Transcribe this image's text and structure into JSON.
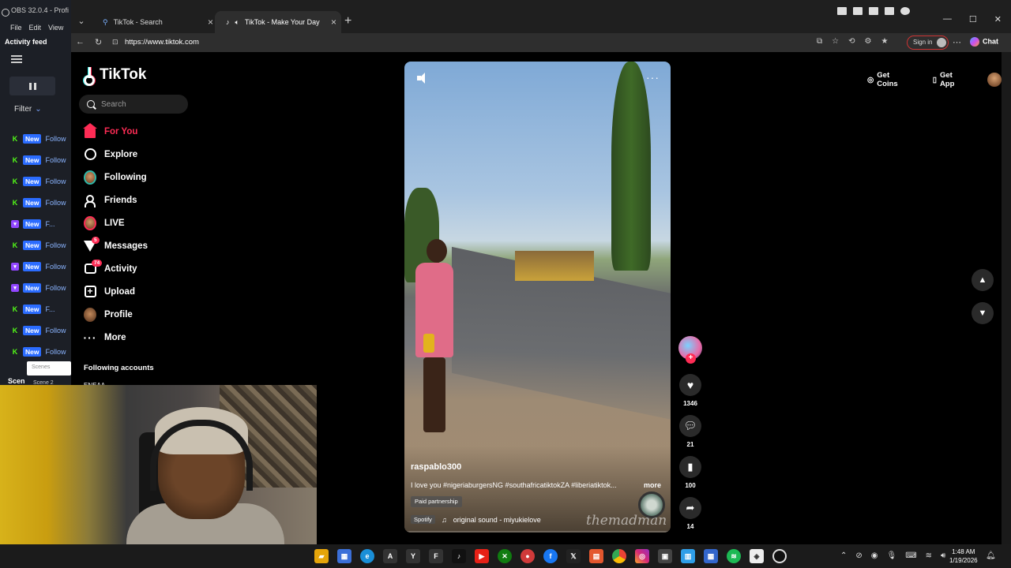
{
  "obs": {
    "title": "OBS 32.0.4 - Profi",
    "menu": [
      "File",
      "Edit",
      "View"
    ],
    "activity_label": "Activity feed",
    "filter_label": "Filter",
    "feed": [
      {
        "source": "kick",
        "badge": "New",
        "text": "Follow"
      },
      {
        "source": "kick",
        "badge": "New",
        "text": "Follow"
      },
      {
        "source": "kick",
        "badge": "New",
        "text": "Follow"
      },
      {
        "source": "kick",
        "badge": "New",
        "text": "Follow"
      },
      {
        "source": "twitch",
        "badge": "New",
        "text": "F..."
      },
      {
        "source": "kick",
        "badge": "New",
        "text": "Follow"
      },
      {
        "source": "twitch",
        "badge": "New",
        "text": "Follow"
      },
      {
        "source": "twitch",
        "badge": "New",
        "text": "Follow"
      },
      {
        "source": "kick",
        "badge": "New",
        "text": "F..."
      },
      {
        "source": "kick",
        "badge": "New",
        "text": "Follow"
      },
      {
        "source": "kick",
        "badge": "New",
        "text": "Follow"
      }
    ],
    "scenes_label": "Scen",
    "scene_popup": "Scenes",
    "scene2": "Scene 2"
  },
  "browser": {
    "tabs": [
      {
        "label": "TikTok - Search",
        "active": false
      },
      {
        "label": "TikTok - Make Your Day",
        "active": true
      }
    ],
    "url": "https://www.tiktok.com",
    "signin_label": "Sign in",
    "chat_label": "Chat"
  },
  "tiktok": {
    "logo": "TikTok",
    "search_placeholder": "Search",
    "nav": [
      {
        "label": "For You",
        "icon": "home-icon",
        "active": true
      },
      {
        "label": "Explore",
        "icon": "compass-icon"
      },
      {
        "label": "Following",
        "icon": "avatar-icon"
      },
      {
        "label": "Friends",
        "icon": "friends-icon"
      },
      {
        "label": "LIVE",
        "icon": "live-icon"
      },
      {
        "label": "Messages",
        "icon": "send-icon",
        "badge": "5"
      },
      {
        "label": "Activity",
        "icon": "activity-icon",
        "badge": "74"
      },
      {
        "label": "Upload",
        "icon": "upload-icon"
      },
      {
        "label": "Profile",
        "icon": "profile-avatar-icon"
      },
      {
        "label": "More",
        "icon": "more-dots-icon"
      }
    ],
    "following_accounts_label": "Following accounts",
    "following_account_partial": "ENEAA",
    "get_coins": "Get Coins",
    "get_app": "Get App",
    "video": {
      "username": "raspablo300",
      "caption": "I love you #nigeriaburgersNG #southafricatiktokZA #liberiatiktok...",
      "more": "more",
      "paid": "Paid partnership",
      "spotify": "Spotify",
      "sound": "original sound - miyukielove",
      "watermark": "themadman"
    },
    "actions": {
      "likes": "1346",
      "comments": "21",
      "saves": "100",
      "shares": "14"
    }
  },
  "taskbar": {
    "time": "1:48 AM",
    "date": "1/19/2026"
  }
}
